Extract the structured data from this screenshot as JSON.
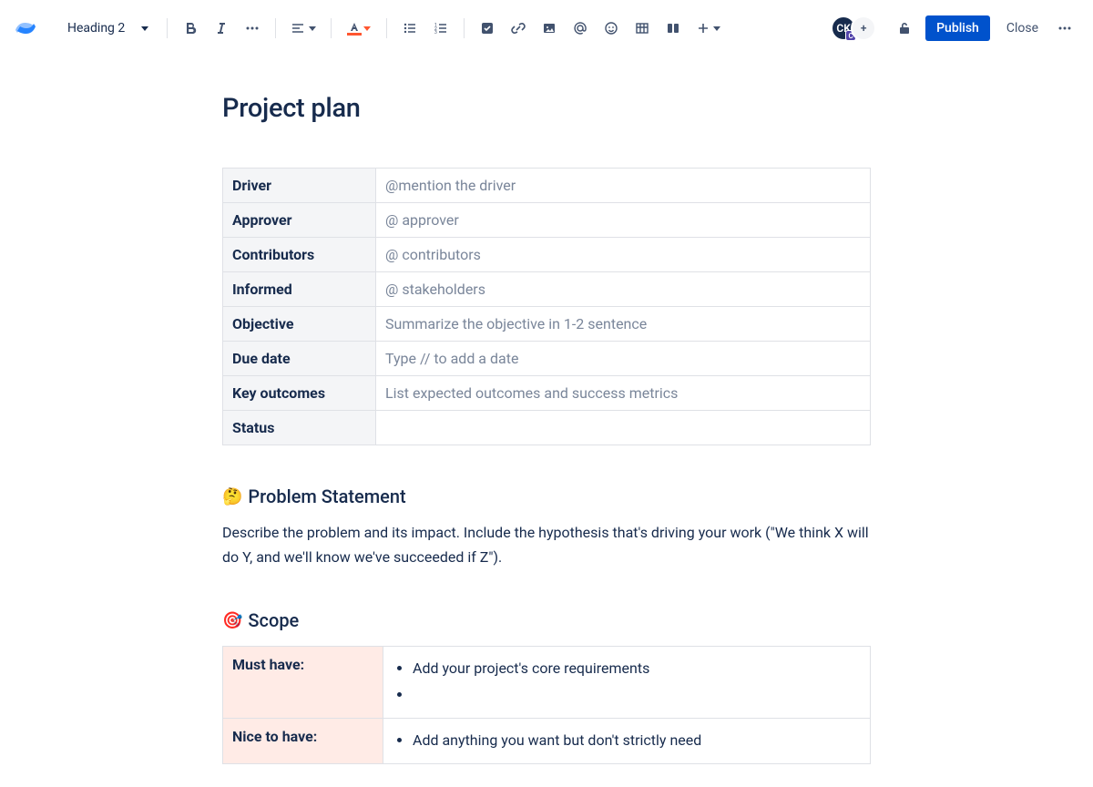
{
  "toolbar": {
    "heading_label": "Heading 2",
    "publish_label": "Publish",
    "close_label": "Close",
    "avatar_initials": "CK",
    "avatar_add": "+",
    "avatar_badge": "C"
  },
  "doc": {
    "title": "Project plan",
    "meta_rows": [
      {
        "label": "Driver",
        "value": "@mention the driver"
      },
      {
        "label": "Approver",
        "value": "@ approver"
      },
      {
        "label": "Contributors",
        "value": "@ contributors"
      },
      {
        "label": "Informed",
        "value": "@ stakeholders"
      },
      {
        "label": "Objective",
        "value": "Summarize the objective in 1-2 sentence"
      },
      {
        "label": "Due date",
        "value": "Type // to add a date"
      },
      {
        "label": "Key outcomes",
        "value": "List expected outcomes and success metrics"
      },
      {
        "label": "Status",
        "value": ""
      }
    ],
    "problem_heading": "Problem Statement",
    "problem_emoji": "🤔",
    "problem_body": "Describe the problem and its impact. Include the hypothesis that's driving your work (\"We think X will do Y, and we'll know we've succeeded if Z\").",
    "scope_heading": "Scope",
    "scope_emoji": "🎯",
    "scope_rows": [
      {
        "label": "Must have:",
        "items": [
          "Add your project's core requirements",
          ""
        ]
      },
      {
        "label": "Nice to have:",
        "items": [
          "Add anything you want but don't strictly need"
        ]
      }
    ]
  }
}
